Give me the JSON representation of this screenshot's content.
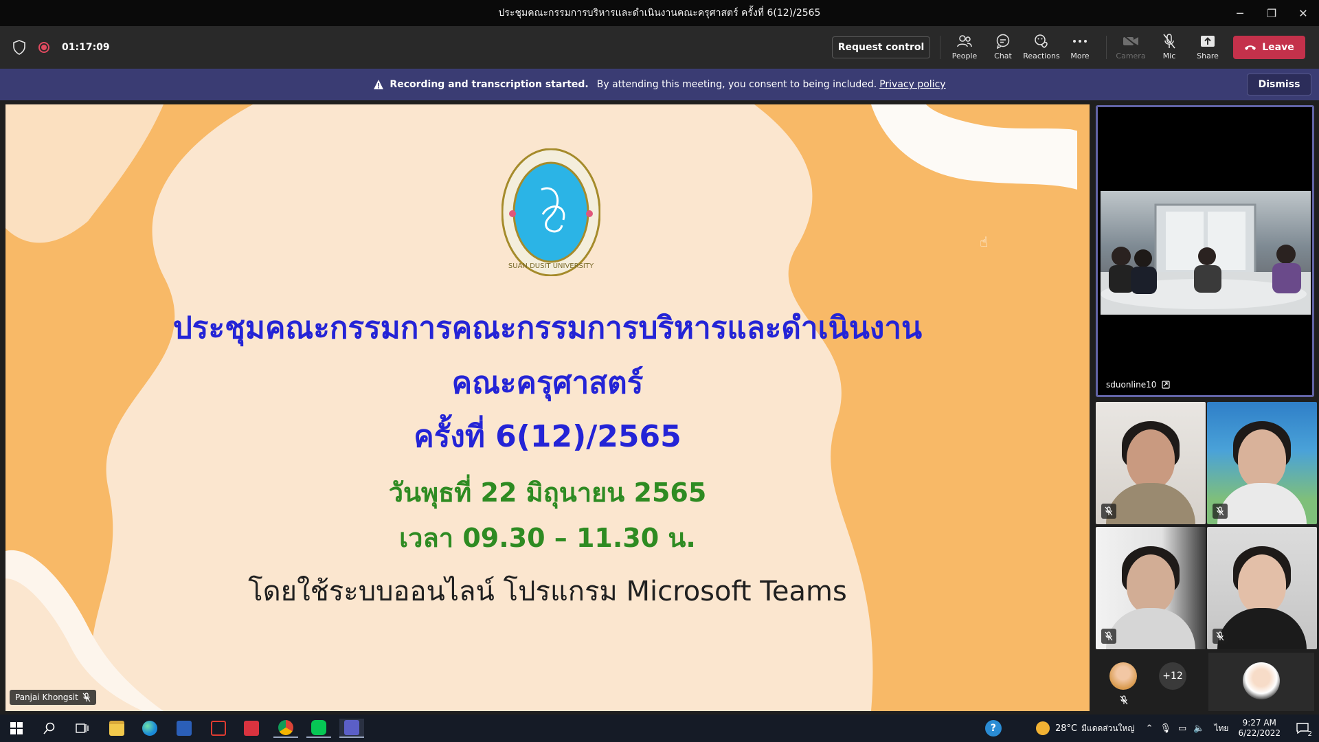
{
  "window": {
    "title": "ประชุมคณะกรรมการบริหารและดำเนินงานคณะครุศาสตร์ ครั้งที่ 6(12)/2565",
    "controls": {
      "minimize": "─",
      "restore": "❐",
      "close": "✕"
    }
  },
  "toolbar": {
    "timer": "01:17:09",
    "request_control": "Request control",
    "items": {
      "people": "People",
      "chat": "Chat",
      "reactions": "Reactions",
      "more": "More",
      "camera": "Camera",
      "mic": "Mic",
      "share": "Share"
    },
    "leave": "Leave",
    "leave_color": "#c4314b"
  },
  "banner": {
    "bold_text": "Recording and transcription started.",
    "text": "By attending this meeting, you consent to being included.",
    "link": "Privacy policy",
    "dismiss": "Dismiss",
    "color": "#3a3c73"
  },
  "slide": {
    "title_line1": "ประชุมคณะกรรมการคณะกรรมการบริหารและดำเนินงาน",
    "title_line2": "คณะครุศาสตร์",
    "title_line3": "ครั้งที่ 6(12)/2565",
    "date": "วันพุธที่ 22 มิถุนายน 2565",
    "time": "เวลา 09.30 – 11.30 น.",
    "platform": "โดยใช้ระบบออนไลน์ โปรแกรม Microsoft Teams",
    "seal_text": "SUAN DUSIT UNIVERSITY",
    "presenter": "Panjai Khongsit"
  },
  "participants": {
    "spotlight_name": "sduonline10",
    "extra_count": "+12"
  },
  "taskbar": {
    "weather": "28°C",
    "location": "มีแดดส่วนใหญ่",
    "language": "ไทย",
    "time": "9:27 AM",
    "date": "6/22/2022",
    "notifications": "2"
  }
}
